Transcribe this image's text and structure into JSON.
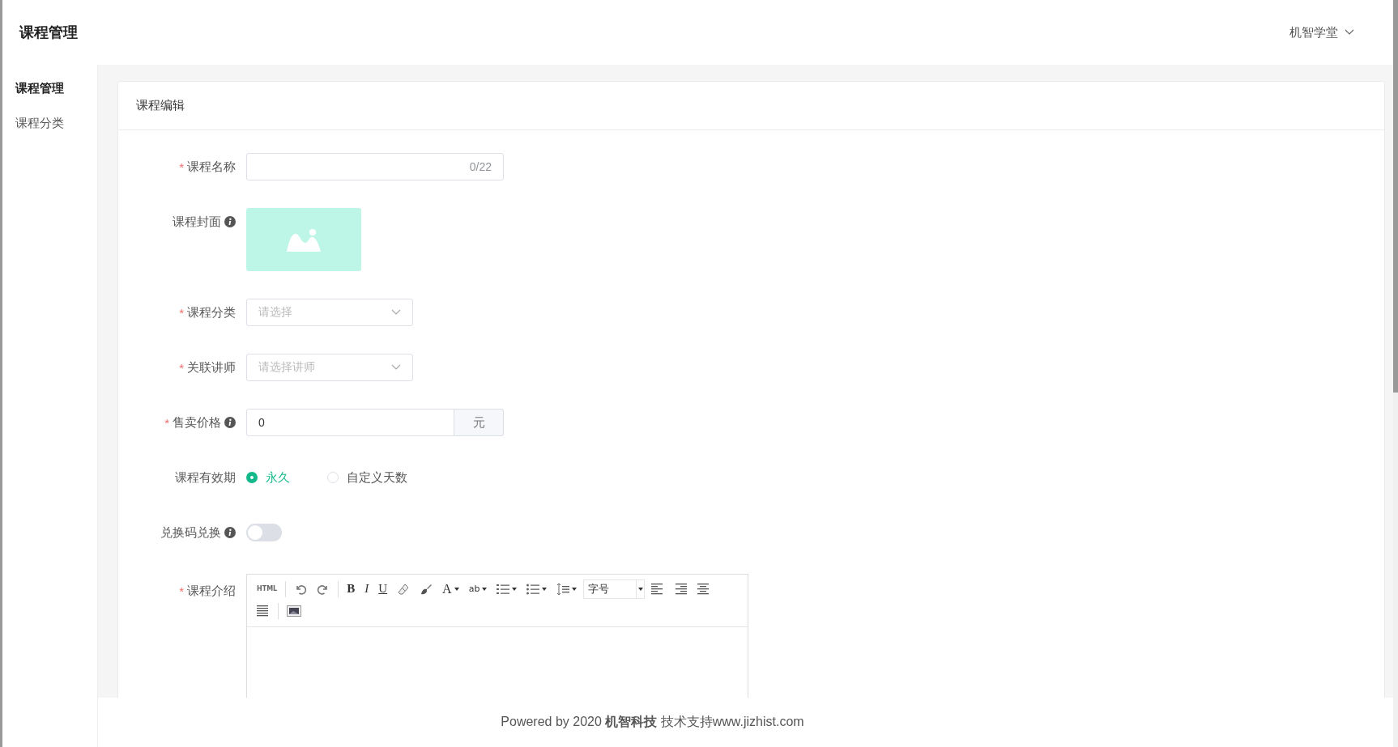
{
  "header": {
    "title": "课程管理",
    "account": "机智学堂"
  },
  "sidebar": {
    "items": [
      {
        "label": "课程管理",
        "selected": true
      },
      {
        "label": "课程分类",
        "selected": false
      }
    ]
  },
  "card": {
    "title": "课程编辑"
  },
  "form": {
    "fields": [
      {
        "kind": "text",
        "label": "课程名称",
        "required_mark": "*",
        "counter": "0/22"
      },
      {
        "kind": "image",
        "label": "课程封面",
        "info": true
      },
      {
        "kind": "select",
        "label": "课程分类",
        "required_mark": "*",
        "placeholder": "请选择"
      },
      {
        "kind": "select",
        "label": "关联讲师",
        "required_mark": "*",
        "placeholder": "请选择讲师"
      },
      {
        "kind": "addon",
        "label": "售卖价格",
        "required_mark": "*",
        "info": true,
        "value": "0",
        "addon": "元"
      },
      {
        "kind": "radio",
        "label": "课程有效期",
        "options": [
          {
            "label": "永久",
            "selected": true
          },
          {
            "label": "自定义天数",
            "selected": false
          }
        ]
      },
      {
        "kind": "switch",
        "label": "兑换码兑换",
        "info": true,
        "on": false
      },
      {
        "kind": "editor",
        "label": "课程介绍",
        "required_mark": "*",
        "toolbar_rows": [
          [
            {
              "kind": "html",
              "label": "HTML"
            },
            {
              "kind": "separator"
            },
            {
              "kind": "undo"
            },
            {
              "kind": "redo"
            },
            {
              "kind": "separator"
            },
            {
              "kind": "bold",
              "label": "B"
            },
            {
              "kind": "italic",
              "label": "I"
            },
            {
              "kind": "underline",
              "label": "U"
            },
            {
              "kind": "eraser"
            },
            {
              "kind": "brush"
            },
            {
              "kind": "font-color",
              "label": "A",
              "dropdown": true
            },
            {
              "kind": "highlight",
              "label": "ab",
              "dropdown": true
            },
            {
              "kind": "ordered-list",
              "dropdown": true
            },
            {
              "kind": "unordered-list",
              "dropdown": true
            },
            {
              "kind": "line-height",
              "dropdown": true
            },
            {
              "kind": "font-size",
              "label": "字号"
            },
            {
              "kind": "align-left"
            },
            {
              "kind": "align-right"
            },
            {
              "kind": "align-center"
            }
          ],
          [
            {
              "kind": "justify"
            },
            {
              "kind": "separator"
            },
            {
              "kind": "image"
            }
          ]
        ]
      }
    ]
  },
  "footer": {
    "text": "Powered by 2020 **机智科技** 技术支持www.jizhist.com"
  }
}
